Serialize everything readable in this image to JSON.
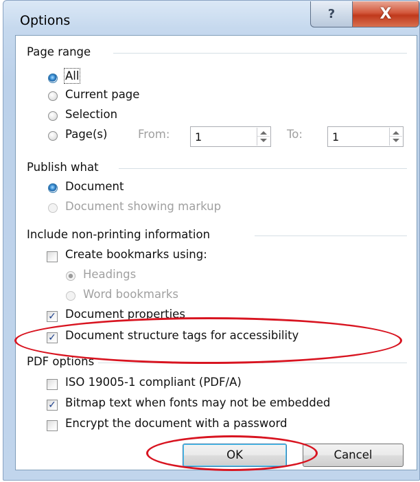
{
  "dialog": {
    "title": "Options",
    "help_glyph": "?",
    "close_glyph": "X"
  },
  "page_range": {
    "heading": "Page range",
    "options": [
      {
        "label": "All",
        "checked": true
      },
      {
        "label": "Current page",
        "checked": false
      },
      {
        "label": "Selection",
        "checked": false
      },
      {
        "label": "Page(s)",
        "checked": false
      }
    ],
    "from_label": "From:",
    "from_value": "1",
    "to_label": "To:",
    "to_value": "1"
  },
  "publish_what": {
    "heading": "Publish what",
    "options": [
      {
        "label": "Document",
        "checked": true,
        "enabled": true
      },
      {
        "label": "Document showing markup",
        "checked": false,
        "enabled": false
      }
    ]
  },
  "non_printing": {
    "heading": "Include non-printing information",
    "create_bookmarks": {
      "label": "Create bookmarks using:",
      "checked": false
    },
    "bookmark_sources": [
      {
        "label": "Headings",
        "checked": true,
        "enabled": false
      },
      {
        "label": "Word bookmarks",
        "checked": false,
        "enabled": false
      }
    ],
    "document_properties": {
      "label": "Document properties",
      "checked": true
    },
    "structure_tags": {
      "label": "Document structure tags for accessibility",
      "checked": true
    }
  },
  "pdf_options": {
    "heading": "PDF options",
    "items": [
      {
        "label": "ISO 19005-1 compliant (PDF/A)",
        "checked": false
      },
      {
        "label": "Bitmap text when fonts may not be embedded",
        "checked": true
      },
      {
        "label": "Encrypt the document with a password",
        "checked": false
      }
    ]
  },
  "buttons": {
    "ok": "OK",
    "cancel": "Cancel"
  },
  "annotation_color": "#d81420",
  "accent_color": "#3c7fb1"
}
